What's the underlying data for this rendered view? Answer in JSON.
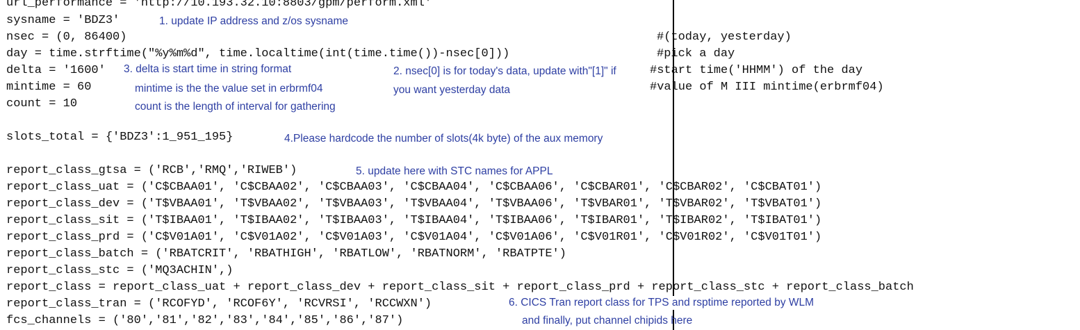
{
  "colors": {
    "annotation": "#2e3fa3",
    "code": "#111111",
    "divider": "#000000",
    "background": "#ffffff"
  },
  "code": {
    "lines": [
      "url_performance = 'http://10.193.32.10:8803/gpm/perform.xml'",
      "sysname = 'BDZ3'",
      "nsec = (0, 86400)",
      "day = time.strftime(\"%y%m%d\", time.localtime(int(time.time())-nsec[0]))",
      "delta = '1600'",
      "mintime = 60",
      "count = 10",
      "",
      "slots_total = {'BDZ3':1_951_195}",
      "",
      "report_class_gtsa = ('RCB','RMQ','RIWEB')",
      "report_class_uat = ('C$CBAA01', 'C$CBAA02', 'C$CBAA03', 'C$CBAA04', 'C$CBAA06', 'C$CBAR01', 'C$CBAR02', 'C$CBAT01')",
      "report_class_dev = ('T$VBAA01', 'T$VBAA02', 'T$VBAA03', 'T$VBAA04', 'T$VBAA06', 'T$VBAR01', 'T$VBAR02', 'T$VBAT01')",
      "report_class_sit = ('T$IBAA01', 'T$IBAA02', 'T$IBAA03', 'T$IBAA04', 'T$IBAA06', 'T$IBAR01', 'T$IBAR02', 'T$IBAT01')",
      "report_class_prd = ('C$V01A01', 'C$V01A02', 'C$V01A03', 'C$V01A04', 'C$V01A06', 'C$V01R01', 'C$V01R02', 'C$V01T01')",
      "report_class_batch = ('RBATCRIT', 'RBATHIGH', 'RBATLOW', 'RBATNORM', 'RBATPTE')",
      "report_class_stc = ('MQ3ACHIN',)",
      "report_class = report_class_uat + report_class_dev + report_class_sit + report_class_prd + report_class_stc + report_class_batch",
      "report_class_tran = ('RCOFYD', 'RCOF6Y', 'RCVRSI', 'RCCWXN')",
      "fcs_channels = ('80','81','82','83','84','85','86','87')"
    ],
    "comments": [
      "#(today, yesterday)",
      "#pick a day",
      "#start time('HHMM') of the day",
      "#value of M III mintime(erbrmf04)"
    ]
  },
  "annotations": [
    "1. update IP address and z/os sysname",
    "3. delta is start time in string format",
    "mintime is the the value set in erbrmf04",
    "count is the length of interval for gathering",
    "2. nsec[0] is for today's data, update with\"[1]\" if",
    "you want yesterday data",
    "4.Please hardcode the number of slots(4k byte) of the aux memory",
    "5. update here with STC names for APPL",
    "6. CICS Tran report class for TPS and rsptime reported by WLM",
    "and finally, put channel chipids here"
  ]
}
